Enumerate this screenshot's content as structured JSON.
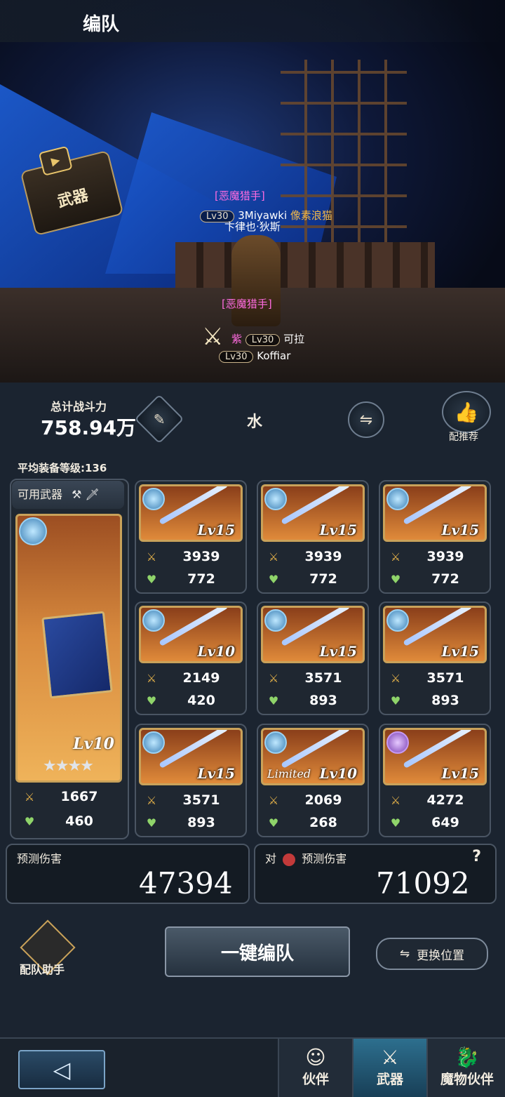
{
  "header": {
    "title": "编队"
  },
  "scene": {
    "badge_label": "武器",
    "tags": [
      {
        "title": "[恶魔猎手]",
        "level": "Lv30",
        "name": "3Miyawki",
        "extra": "像素浪猫",
        "sub": "卞律也·狄斯"
      },
      {
        "title": "[恶魔猎手]",
        "level": "Lv30",
        "name": "可拉",
        "prefix": "紫",
        "level2": "Lv30",
        "name2": "Koffiar"
      }
    ]
  },
  "stats": {
    "total_power_label": "总计战斗力",
    "total_power_value": "758.94万",
    "element": "水",
    "recommend_label": "配推荐",
    "avg_level_label": "平均装备等级:136"
  },
  "available": {
    "label": "可用武器"
  },
  "main_weapon": {
    "level": "Lv10",
    "stars": "★★★★",
    "atk": "1667",
    "hp": "460"
  },
  "weapons": [
    {
      "level": "Lv15",
      "atk": "3939",
      "hp": "772",
      "limited": ""
    },
    {
      "level": "Lv15",
      "atk": "3939",
      "hp": "772",
      "limited": ""
    },
    {
      "level": "Lv15",
      "atk": "3939",
      "hp": "772",
      "limited": ""
    },
    {
      "level": "Lv10",
      "atk": "2149",
      "hp": "420",
      "limited": ""
    },
    {
      "level": "Lv15",
      "atk": "3571",
      "hp": "893",
      "limited": ""
    },
    {
      "level": "Lv15",
      "atk": "3571",
      "hp": "893",
      "limited": ""
    },
    {
      "level": "Lv15",
      "atk": "3571",
      "hp": "893",
      "limited": ""
    },
    {
      "level": "Lv10",
      "atk": "2069",
      "hp": "268",
      "limited": "Limited"
    },
    {
      "level": "Lv15",
      "atk": "4272",
      "hp": "649",
      "limited": ""
    }
  ],
  "damage": {
    "predicted_label": "预测伤害",
    "predicted_value": "47394",
    "vs_prefix": "对",
    "vs_label": "预测伤害",
    "vs_value": "71092",
    "help": "?"
  },
  "actions": {
    "auto_formation": "一键编队",
    "swap_position": "更换位置",
    "assistant": "配队助手"
  },
  "tabs": [
    {
      "label": "伙伴",
      "icon": "companion-icon"
    },
    {
      "label": "武器",
      "icon": "weapon-icon"
    },
    {
      "label": "魔物伙伴",
      "icon": "monster-icon"
    }
  ],
  "colors": {
    "accent": "#c9a25a",
    "atk": "#e2b04a",
    "hp": "#8fd46a",
    "active_tab": "#2d6f8e"
  }
}
